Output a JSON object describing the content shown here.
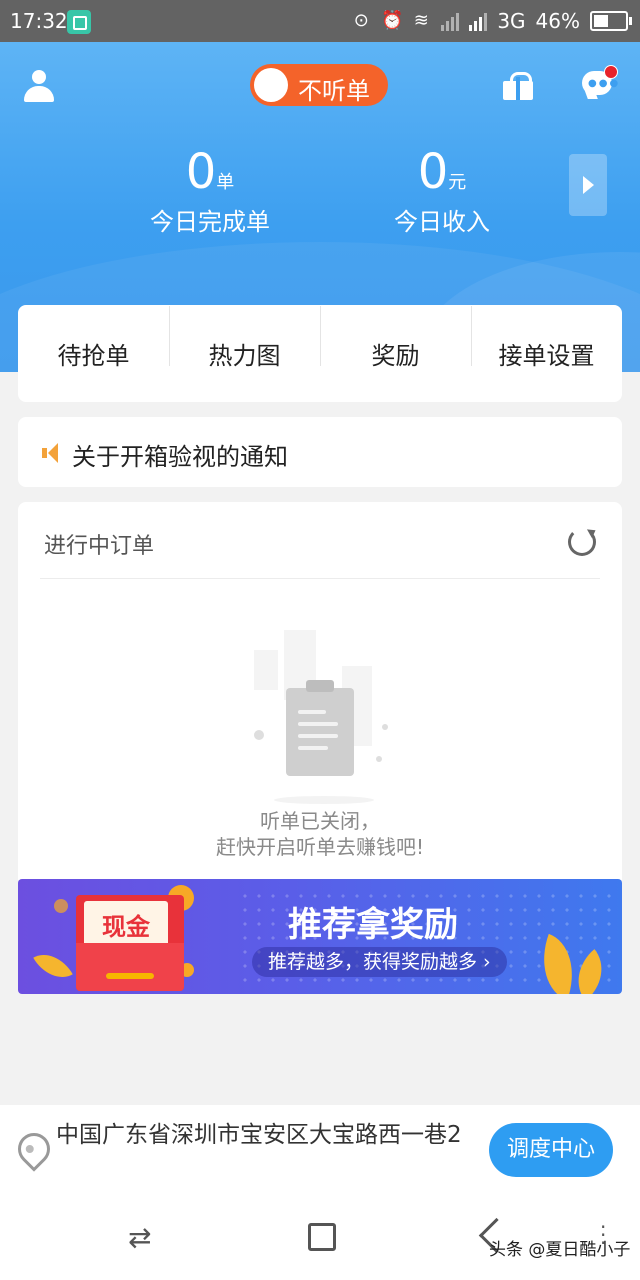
{
  "status_bar": {
    "time": "17:32",
    "network": "3G",
    "battery": "46%",
    "battery_level": 0.46
  },
  "header": {
    "toggle_label": "不听单",
    "stats": [
      {
        "value": "0",
        "unit": "单",
        "caption": "今日完成单"
      },
      {
        "value": "0",
        "unit": "元",
        "caption": "今日收入"
      }
    ]
  },
  "menu": {
    "items": [
      "待抢单",
      "热力图",
      "奖励",
      "接单设置"
    ]
  },
  "notice": {
    "text": "关于开箱验视的通知"
  },
  "orders": {
    "title": "进行中订单",
    "empty_line1": "听单已关闭，",
    "empty_line2": "赶快开启听单去赚钱吧!"
  },
  "banner": {
    "envelope_text": "现金",
    "headline": "推荐拿奖励",
    "pill": "推荐越多，获得奖励越多 ›"
  },
  "bottom": {
    "address": "中国广东省深圳市宝安区大宝路西一巷2",
    "dispatch_label": "调度中心"
  },
  "watermark": "头条 @夏日酷小子",
  "colors": {
    "primary": "#3d9ff0",
    "toggle": "#f4632a",
    "button": "#2e9df2",
    "badge": "#e8232b"
  }
}
